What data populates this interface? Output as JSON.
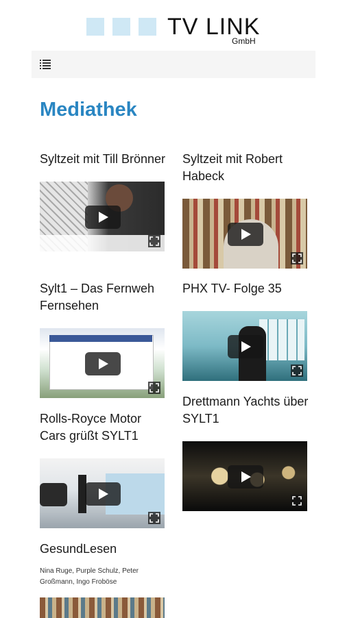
{
  "brand": {
    "name": "TV LINK",
    "suffix": "GmbH"
  },
  "page": {
    "title": "Mediathek"
  },
  "videos": [
    {
      "title": "Syltzeit mit Till Brönner"
    },
    {
      "title": "Syltzeit mit Robert Habeck"
    },
    {
      "title": "Sylt1 – Das Fernweh Fernsehen"
    },
    {
      "title": "PHX TV- Folge 35"
    },
    {
      "title": "Rolls-Royce Motor Cars grüßt SYLT1"
    },
    {
      "title": "Drettmann Yachts über SYLT1"
    },
    {
      "title": "GesundLesen",
      "subtitle": "Nina Ruge, Purple Schulz, Peter Großmann, Ingo Froböse"
    }
  ],
  "icons": {
    "menu": "list-menu-icon",
    "play": "play-icon",
    "expand": "fullscreen-icon"
  },
  "colors": {
    "accent": "#2a86c2",
    "logo_square": "#cfe8f5",
    "navbar_bg": "#f5f5f5"
  }
}
